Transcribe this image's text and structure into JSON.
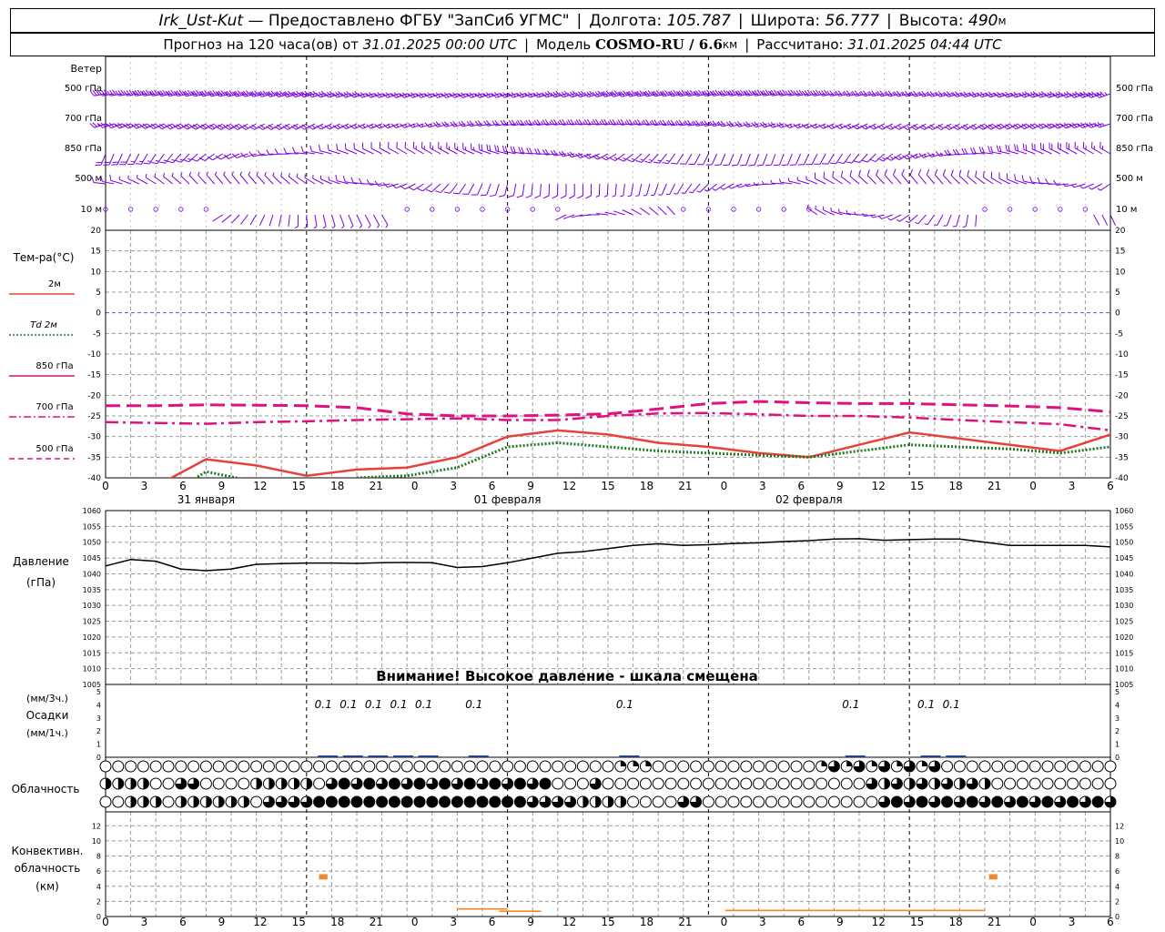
{
  "header": {
    "station": "Irk_Ust-Kut",
    "provider": "— Предоставлено ФГБУ \"ЗапСиб УГМС\"",
    "lon_label": "Долгота:",
    "lon": "105.787",
    "lat_label": "Широта:",
    "lat": "56.777",
    "alt_label": "Высота:",
    "alt": "490",
    "alt_unit": "м",
    "forecast_label": "Прогноз на 120 часа(ов) от",
    "forecast_from": "31.01.2025 00:00 UTC",
    "model_label": "Модель",
    "model": "COSMO-RU / 6.6",
    "model_unit": "км",
    "calc_label": "Рассчитано:",
    "calc_time": "31.01.2025 04:44 UTC",
    "separator": "|"
  },
  "wind": {
    "title": "Ветер",
    "levels": [
      "500 гПа",
      "700 гПа",
      "850 гПа",
      "500 м",
      "10  м"
    ],
    "color": "#7a00e0"
  },
  "temperature": {
    "title": "Тем-ра(°C)",
    "legend": [
      {
        "label": "2м",
        "color": "#e8413c",
        "style": "solid"
      },
      {
        "label": "Td  2м",
        "color": "#1f7a1f",
        "style": "dotted"
      },
      {
        "label": "850 гПа",
        "color": "#cc1177",
        "style": "solid"
      },
      {
        "label": "700 гПа",
        "color": "#e0117f",
        "style": "dashdot"
      },
      {
        "label": "500 гПа",
        "color": "#e0117f",
        "style": "dashed"
      }
    ],
    "y_ticks": [
      "20",
      "15",
      "10",
      "5",
      "0",
      "-5",
      "-10",
      "-15",
      "-20",
      "-25",
      "-30",
      "-35",
      "-40"
    ]
  },
  "time_axis": {
    "hour_labels": [
      "0",
      "3",
      "6",
      "9",
      "12",
      "15",
      "18",
      "21",
      "0",
      "3",
      "6",
      "9",
      "12",
      "15",
      "18",
      "21",
      "0",
      "3",
      "6",
      "9",
      "12",
      "15",
      "18",
      "21",
      "0",
      "3",
      "6"
    ],
    "dates": [
      "31 января",
      "01 февраля",
      "02 февраля"
    ]
  },
  "pressure": {
    "title_line1": "Давление",
    "title_line2": "(гПа)",
    "y_ticks": [
      "1060",
      "1055",
      "1050",
      "1045",
      "1040",
      "1035",
      "1030",
      "1025",
      "1020",
      "1015",
      "1010",
      "1005"
    ],
    "warning": "Внимание! Высокое давление - шкала смещена"
  },
  "precip": {
    "unit3": "(мм/3ч.)",
    "title": "Осадки",
    "unit1": "(мм/1ч.)",
    "y_ticks": [
      "5",
      "4",
      "3",
      "2",
      "1",
      "0"
    ],
    "labels": [
      {
        "hour": 26,
        "text": "0.1"
      },
      {
        "hour": 29,
        "text": "0.1"
      },
      {
        "hour": 32,
        "text": "0.1"
      },
      {
        "hour": 35,
        "text": "0.1"
      },
      {
        "hour": 38,
        "text": "0.1"
      },
      {
        "hour": 44,
        "text": "0.1"
      },
      {
        "hour": 62,
        "text": "0.1"
      },
      {
        "hour": 89,
        "text": "0.1"
      },
      {
        "hour": 98,
        "text": "0.1"
      },
      {
        "hour": 101,
        "text": "0.1"
      }
    ]
  },
  "cloud": {
    "title": "Облачность"
  },
  "convective": {
    "title_line1": "Конвективн.",
    "title_line2": "облачность",
    "title_line3": "(км)",
    "y_ticks": [
      "12",
      "10",
      "8",
      "6",
      "4",
      "2",
      "0"
    ],
    "color": "#f08a2a"
  },
  "chart_data": [
    {
      "type": "line",
      "title": "Тем-ра(°C)",
      "x_unit": "hours since 31.01.2025 00:00 UTC",
      "ylim": [
        -40,
        20
      ],
      "x": [
        0,
        6,
        12,
        18,
        24,
        30,
        36,
        42,
        48,
        54,
        60,
        66,
        72,
        78,
        84,
        90,
        96,
        102,
        108,
        114,
        120
      ],
      "series": [
        {
          "name": "2м",
          "values": [
            -48,
            -42,
            -35.5,
            -37,
            -39.5,
            -38,
            -37.5,
            -35,
            -30,
            -28.5,
            -29.5,
            -31.5,
            -32.5,
            -34,
            -35,
            -32,
            -29,
            -30.5,
            -32,
            -33.5,
            -29.5
          ]
        },
        {
          "name": "Td  2м",
          "values": [
            -50,
            -46,
            -38.5,
            -41,
            -43,
            -40,
            -39.5,
            -37.5,
            -32.5,
            -31.5,
            -32.5,
            -33.5,
            -34,
            -34.5,
            -35,
            -33.5,
            -32,
            -32.5,
            -33,
            -34,
            -32.5
          ]
        },
        {
          "name": "700 гПа",
          "values": [
            -26.5,
            -26.7,
            -26.9,
            -26.5,
            -26.3,
            -26.0,
            -25.8,
            -25.6,
            -26.0,
            -26.0,
            -25.0,
            -24.4,
            -24.3,
            -24.6,
            -25.0,
            -25.0,
            -25.4,
            -26.0,
            -26.5,
            -27.0,
            -28.5
          ]
        },
        {
          "name": "500 гПа",
          "values": [
            -22.5,
            -22.5,
            -22.3,
            -22.4,
            -22.5,
            -23.0,
            -24.5,
            -25.0,
            -25.0,
            -24.8,
            -24.5,
            -23.3,
            -22.0,
            -21.5,
            -21.8,
            -22.0,
            -22.0,
            -22.3,
            -22.6,
            -23.0,
            -24.0
          ]
        }
      ]
    },
    {
      "type": "line",
      "title": "Давление",
      "ylabel": "(гПа)",
      "x_unit": "hours since 31.01.2025 00:00 UTC",
      "ylim": [
        1005,
        1060
      ],
      "x": [
        0,
        3,
        6,
        9,
        12,
        15,
        18,
        21,
        24,
        27,
        30,
        33,
        36,
        39,
        42,
        45,
        48,
        51,
        54,
        57,
        60,
        63,
        66,
        69,
        72,
        75,
        78,
        81,
        84,
        87,
        90,
        93,
        96,
        99,
        102,
        105,
        108,
        111,
        114,
        117,
        120
      ],
      "series": [
        {
          "name": "Давление",
          "values": [
            1042.5,
            1044.5,
            1044,
            1041.5,
            1041,
            1041.5,
            1043,
            1043.2,
            1043.4,
            1043.4,
            1043.3,
            1043.5,
            1043.6,
            1043.5,
            1042,
            1042.3,
            1043.5,
            1045,
            1046.5,
            1047,
            1048,
            1049,
            1049.5,
            1049,
            1049.2,
            1049.6,
            1049.8,
            1050.2,
            1050.5,
            1051,
            1051.1,
            1050.6,
            1050.8,
            1051,
            1051,
            1050,
            1049,
            1049,
            1049,
            1049,
            1048.5
          ]
        }
      ]
    },
    {
      "type": "bar",
      "title": "Осадки",
      "ylabel": "(мм/3ч.)",
      "ylim": [
        0,
        5
      ],
      "categories": [
        26,
        29,
        32,
        35,
        38,
        44,
        62,
        89,
        98,
        101
      ],
      "values": [
        0.1,
        0.1,
        0.1,
        0.1,
        0.1,
        0.1,
        0.1,
        0.1,
        0.1,
        0.1
      ]
    },
    {
      "type": "bar",
      "title": "Конвективн. облачность",
      "ylabel": "(км)",
      "ylim": [
        0,
        13
      ],
      "bars": [
        {
          "x_start": 25.5,
          "x_end": 26.5,
          "bottom": 4.9,
          "top": 5.6
        },
        {
          "x_start": 105.5,
          "x_end": 106.5,
          "bottom": 4.9,
          "top": 5.6
        },
        {
          "x_start": 42,
          "x_end": 48,
          "bottom": 0.9,
          "top": 1.1
        },
        {
          "x_start": 47,
          "x_end": 52,
          "bottom": 0.6,
          "top": 0.8
        },
        {
          "x_start": 74,
          "x_end": 105,
          "bottom": 0.7,
          "top": 0.9
        }
      ]
    }
  ]
}
